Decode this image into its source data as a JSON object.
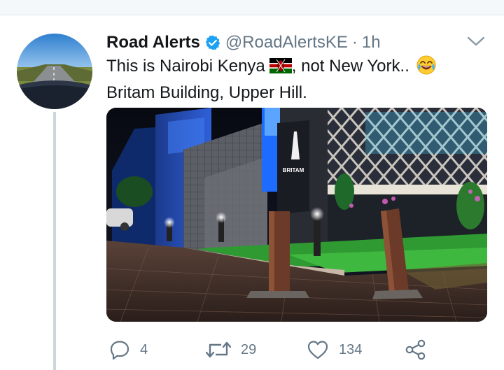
{
  "tweet": {
    "author_name": "Road Alerts",
    "handle": "@RoadAlertsKE",
    "separator": "·",
    "time": "1h",
    "text_line1": "This is Nairobi Kenya",
    "text_line1_tail": ", not New York..",
    "text_line2": "Britam Building, Upper Hill.",
    "flag_icon": "kenya-flag-emoji",
    "laugh_icon": "face-with-tears-of-joy-emoji",
    "media_sign_text": "BRITAM"
  },
  "actions": {
    "reply_count": "4",
    "retweet_count": "29",
    "like_count": "134"
  },
  "colors": {
    "verified_blue": "#1da1f2",
    "icon_gray": "#657786",
    "thread_line": "#ccd6dd"
  }
}
